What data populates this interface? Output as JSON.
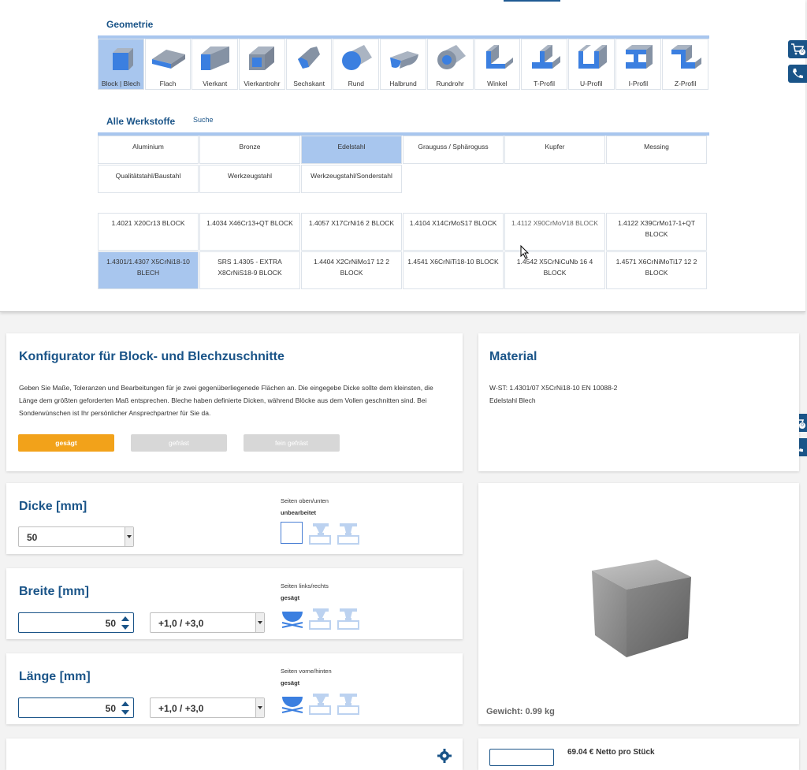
{
  "geometry": {
    "title": "Geometrie",
    "items": [
      {
        "label": "Block | Blech",
        "icon": "block-icon",
        "selected": true
      },
      {
        "label": "Flach",
        "icon": "flat-icon"
      },
      {
        "label": "Vierkant",
        "icon": "square-bar-icon"
      },
      {
        "label": "Vierkantrohr",
        "icon": "square-tube-icon"
      },
      {
        "label": "Sechskant",
        "icon": "hexagon-bar-icon"
      },
      {
        "label": "Rund",
        "icon": "round-bar-icon"
      },
      {
        "label": "Halbrund",
        "icon": "half-round-icon"
      },
      {
        "label": "Rundrohr",
        "icon": "round-tube-icon"
      },
      {
        "label": "Winkel",
        "icon": "angle-profile-icon"
      },
      {
        "label": "T-Profil",
        "icon": "t-profile-icon"
      },
      {
        "label": "U-Profil",
        "icon": "u-profile-icon"
      },
      {
        "label": "I-Profil",
        "icon": "i-profile-icon"
      },
      {
        "label": "Z-Profil",
        "icon": "z-profile-icon"
      }
    ]
  },
  "materials": {
    "title": "Alle Werkstoffe",
    "search_label": "Suche",
    "row1": [
      "Aluminium",
      "Bronze",
      "Edelstahl",
      "Grauguss / Sphäroguss",
      "Kupfer",
      "Messing"
    ],
    "row2": [
      "Qualitätstahl/Baustahl",
      "Werkzeugstahl",
      "Werkzeugstahl/Sonderstahl"
    ],
    "selected": "Edelstahl"
  },
  "grades": {
    "row1": [
      "1.4021 X20Cr13 BLOCK",
      "1.4034 X46Cr13+QT BLOCK",
      "1.4057 X17CrNi16 2 BLOCK",
      "1.4104 X14CrMoS17 BLOCK",
      "1.4112 X90CrMoV18 BLOCK",
      "1.4122 X39CrMo17-1+QT BLOCK"
    ],
    "row2": [
      "1.4301/1.4307 X5CrNi18-10 BLECH",
      "SRS 1.4305 - EXTRA X8CrNiS18-9 BLOCK",
      "1.4404 X2CrNiMo17 12 2 BLOCK",
      "1.4541 X6CrNiTi18-10 BLOCK",
      "1.4542 X5CrNiCuNb 16 4 BLOCK",
      "1.4571 X6CrNiMoTi17 12 2 BLOCK"
    ],
    "selected": "1.4301/1.4307 X5CrNi18-10 BLECH"
  },
  "side_buttons": {
    "cart_count": "0",
    "cart_icon": "cart-icon",
    "phone_icon": "phone-icon"
  },
  "configurator": {
    "title": "Konfigurator für Block- und Blechzuschnitte",
    "description": "Geben Sie Maße, Toleranzen und Bearbeitungen für je zwei gegenüberliegenede Flächen an. Die eingegebe Dicke sollte dem kleinsten, die Länge dem größten geforderten Maß entsprechen. Bleche haben definierte Dicken, während Blöcke aus dem Vollen geschnitten sind. Bei Sonderwünschen ist Ihr persönlicher Ansprechpartner für Sie da.",
    "buttons": [
      "gesägt",
      "gefräst",
      "fein gefräst"
    ],
    "active_button": "gesägt"
  },
  "material_panel": {
    "title": "Material",
    "line1": "W-ST: 1.4301/07 X5CrNi18-10 EN 10088-2",
    "line2": "Edelstahl Blech"
  },
  "dimensions": {
    "dicke": {
      "title": "Dicke [mm]",
      "value": "50",
      "sides_label": "Seiten oben/unten",
      "processing": "unbearbeitet"
    },
    "breite": {
      "title": "Breite [mm]",
      "value": "50",
      "tolerance": "+1,0 / +3,0",
      "sides_label": "Seiten links/rechts",
      "processing": "gesägt"
    },
    "laenge": {
      "title": "Länge [mm]",
      "value": "50",
      "tolerance": "+1,0 / +3,0",
      "sides_label": "Seiten vorne/hinten",
      "processing": "gesägt"
    }
  },
  "preview": {
    "weight": "Gewicht: 0.99 kg"
  },
  "pricing": {
    "price": "69.04 € Netto pro Stück"
  },
  "colors": {
    "brand_blue": "#1a5488",
    "selected_bg": "#a8c6ee",
    "active_orange": "#f2a21a"
  }
}
